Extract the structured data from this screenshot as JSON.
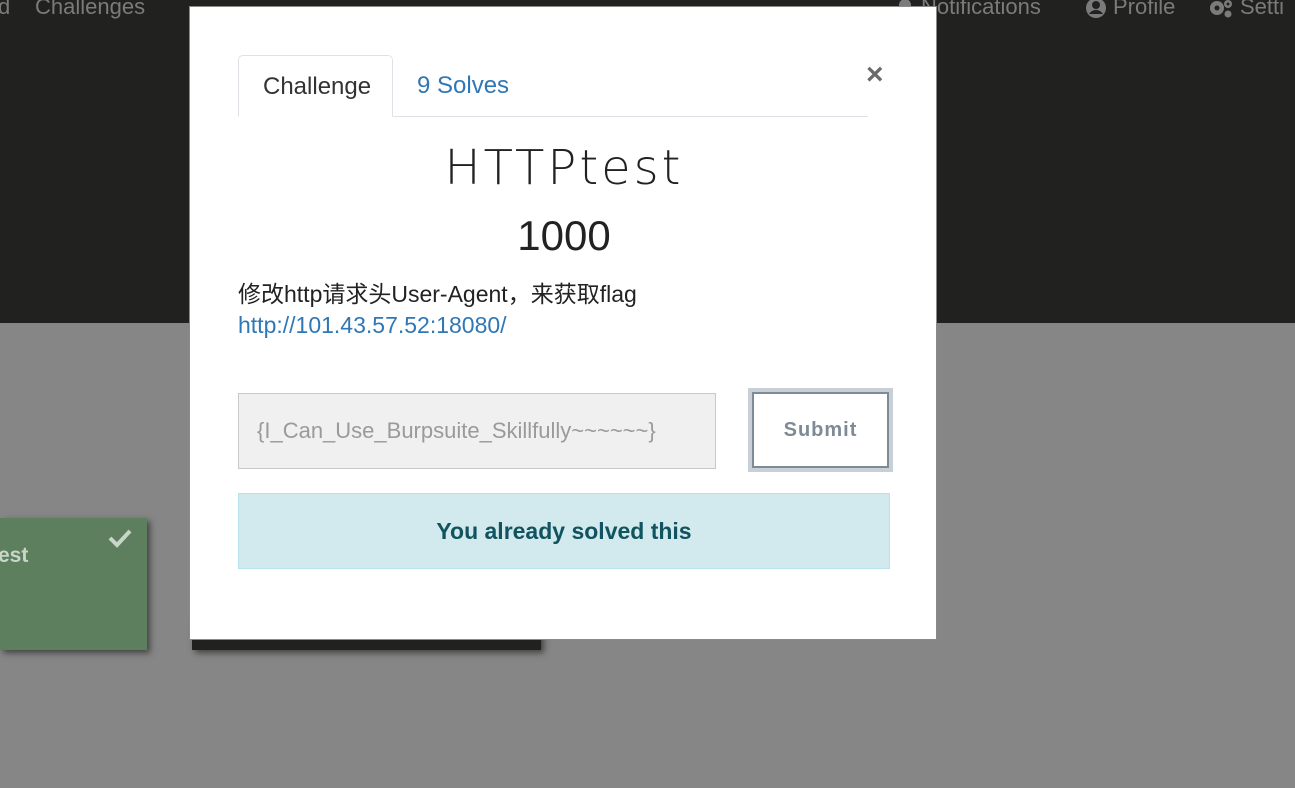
{
  "navbar": {
    "left_partial": "d",
    "challenges": "Challenges",
    "notifications": "Notifications",
    "profile": "Profile",
    "settings": "Setti"
  },
  "background_card": {
    "label_partial": "est"
  },
  "modal": {
    "tabs": {
      "challenge": "Challenge",
      "solves": "9 Solves"
    },
    "close_symbol": "×",
    "title": "HTTPtest",
    "points": "1000",
    "description": "修改http请求头User-Agent，来获取flag",
    "link": "http://101.43.57.52:18080/",
    "flag_input_value": "{I_Can_Use_Burpsuite_Skillfully~~~~~~}",
    "submit_label": "Submit",
    "notice": "You already solved this"
  },
  "colors": {
    "link": "#2f77b5",
    "notice_bg": "#d2e9ee",
    "notice_text": "#11535e",
    "card_solved": "#5d7f5d"
  },
  "icons": [
    "bell-icon",
    "user-circle-icon",
    "gears-icon",
    "check-icon",
    "close-icon"
  ]
}
